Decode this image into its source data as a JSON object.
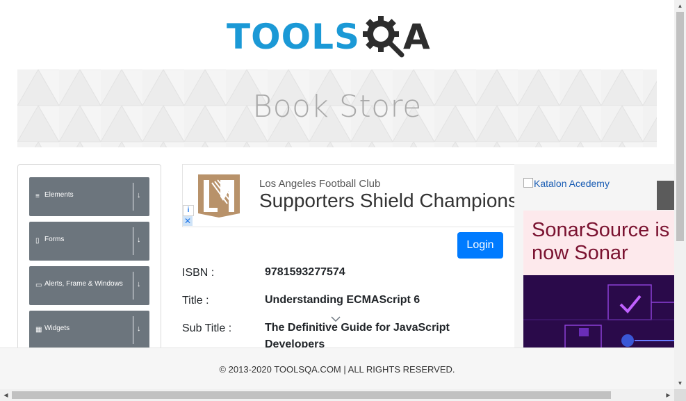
{
  "logo": {
    "part1": "TOOLS",
    "part2": "A"
  },
  "banner": {
    "title": "Book Store"
  },
  "sidebar": {
    "groups": [
      {
        "label": "Elements",
        "icon": "≡"
      },
      {
        "label": "Forms",
        "icon": "▯"
      },
      {
        "label": "Alerts, Frame & Windows",
        "icon": "▭"
      },
      {
        "label": "Widgets",
        "icon": "▦"
      }
    ],
    "arrow": "↓"
  },
  "ad": {
    "small": "Los Angeles Football Club",
    "big": "Supporters Shield Champions",
    "info": "i",
    "close": "✕"
  },
  "login": {
    "label": "Login"
  },
  "book": {
    "isbn_label": "ISBN :",
    "isbn": "9781593277574",
    "title_label": "Title :",
    "title": "Understanding ECMAScript 6",
    "subtitle_label": "Sub Title :",
    "subtitle": "The Definitive Guide for JavaScript Developers"
  },
  "right_ad": {
    "katalon": "Katalon Acedemy",
    "sonar": "SonarSource is now Sonar"
  },
  "footer": {
    "text": "© 2013-2020 TOOLSQA.COM | ALL RIGHTS RESERVED."
  },
  "colors": {
    "brand_blue": "#1b99d6",
    "primary": "#007bff",
    "menu_gray": "#6c757d"
  }
}
